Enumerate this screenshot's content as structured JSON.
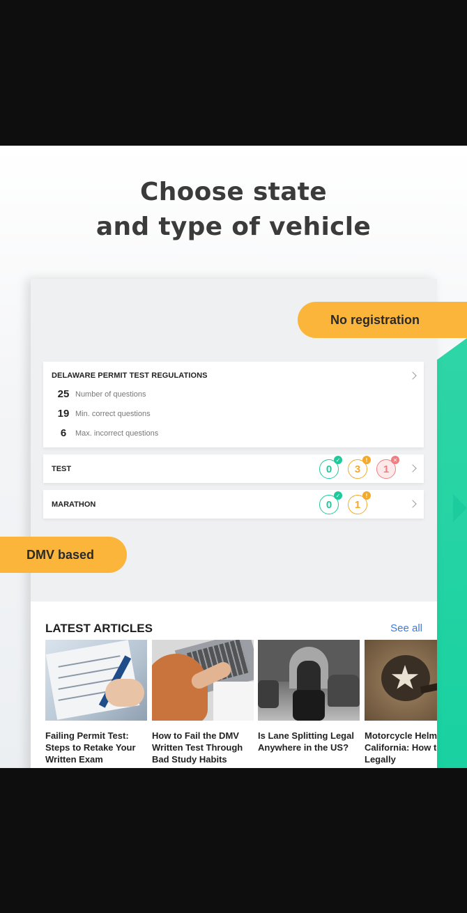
{
  "headline": {
    "line1": "Choose state",
    "line2": "and type of vehicle"
  },
  "badges": {
    "no_registration": "No registration",
    "dmv_based": "DMV based"
  },
  "regulations": {
    "title": "DELAWARE  PERMIT TEST REGULATIONS",
    "stats": [
      {
        "value": "25",
        "label": "Number of questions"
      },
      {
        "value": "19",
        "label": "Min. correct questions"
      },
      {
        "value": "6",
        "label": "Max. incorrect questions"
      }
    ]
  },
  "modes": {
    "test": {
      "label": "TEST",
      "correct": "0",
      "warning": "3",
      "incorrect": "1"
    },
    "marathon": {
      "label": "MARATHON",
      "correct": "0",
      "warning": "1"
    }
  },
  "articles": {
    "title": "LATEST ARTICLES",
    "see_all": "See all",
    "items": [
      {
        "title": "Failing Permit Test: Steps to Retake Your Written Exam"
      },
      {
        "title": "How to Fail the DMV Written Test Through Bad Study Habits"
      },
      {
        "title": "Is Lane Splitting Legal Anywhere in the US?"
      },
      {
        "title": "Motorcycle Helmet California: How to Legally"
      }
    ]
  },
  "icons": {
    "check": "check-icon",
    "warning": "exclamation-icon",
    "error": "x-icon",
    "chevron": "chevron-right-icon"
  },
  "colors": {
    "accent_orange": "#fbb53b",
    "accent_green": "#1fc99a",
    "error_red": "#f07d80",
    "link_blue": "#3e7ad6"
  }
}
